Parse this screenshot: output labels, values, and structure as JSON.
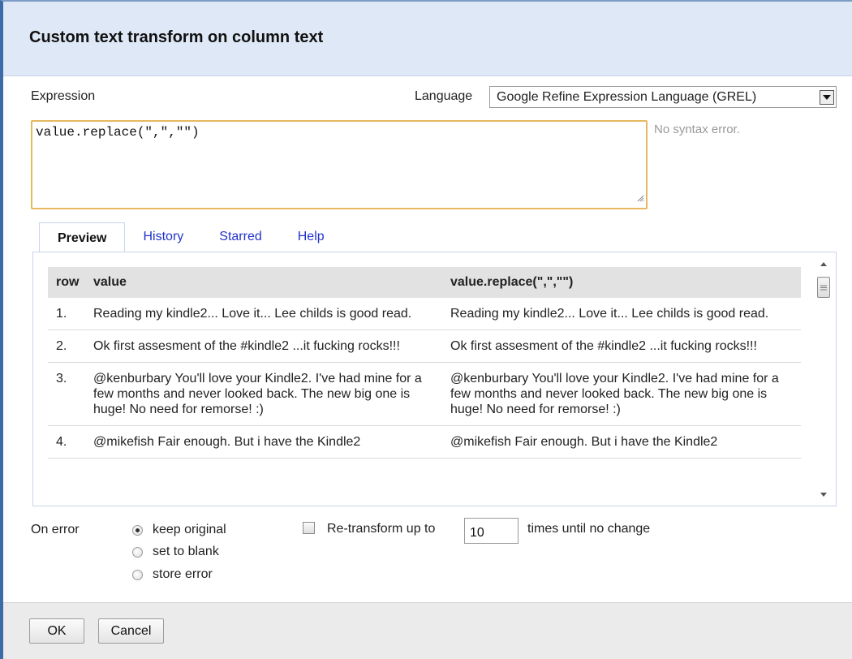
{
  "dialog": {
    "title": "Custom text transform on column text"
  },
  "expression": {
    "label": "Expression",
    "value": "value.replace(\",\",\"\")",
    "status": "No syntax error."
  },
  "language": {
    "label": "Language",
    "selected": "Google Refine Expression Language (GREL)"
  },
  "tabs": [
    {
      "label": "Preview",
      "active": true
    },
    {
      "label": "History",
      "active": false
    },
    {
      "label": "Starred",
      "active": false
    },
    {
      "label": "Help",
      "active": false
    }
  ],
  "preview": {
    "headers": [
      "row",
      "value",
      "value.replace(\",\",\"\")"
    ],
    "rows": [
      {
        "num": "1.",
        "value": "Reading my kindle2... Love it... Lee childs is good read.",
        "result": "Reading my kindle2... Love it... Lee childs is good read."
      },
      {
        "num": "2.",
        "value": "Ok first assesment of the #kindle2 ...it fucking rocks!!!",
        "result": "Ok first assesment of the #kindle2 ...it fucking rocks!!!"
      },
      {
        "num": "3.",
        "value": "@kenburbary You'll love your Kindle2. I've had mine for a few months and never looked back. The new big one is huge! No need for remorse! :)",
        "result": "@kenburbary You'll love your Kindle2. I've had mine for a few months and never looked back. The new big one is huge! No need for remorse! :)"
      },
      {
        "num": "4.",
        "value": "@mikefish Fair enough. But i have the Kindle2",
        "result": "@mikefish Fair enough. But i have the Kindle2"
      }
    ]
  },
  "on_error": {
    "label": "On error",
    "options": [
      {
        "label": "keep original",
        "selected": true
      },
      {
        "label": "set to blank",
        "selected": false
      },
      {
        "label": "store error",
        "selected": false
      }
    ]
  },
  "retransform": {
    "checked": false,
    "label_before": "Re-transform up to",
    "times_value": "10",
    "label_after": "times until no change"
  },
  "buttons": {
    "ok": "OK",
    "cancel": "Cancel"
  },
  "colors": {
    "title_bar": "#dfe8f6",
    "expression_border": "#e6b860",
    "tab_link": "#2233cc",
    "table_header": "#e2e2e2"
  }
}
